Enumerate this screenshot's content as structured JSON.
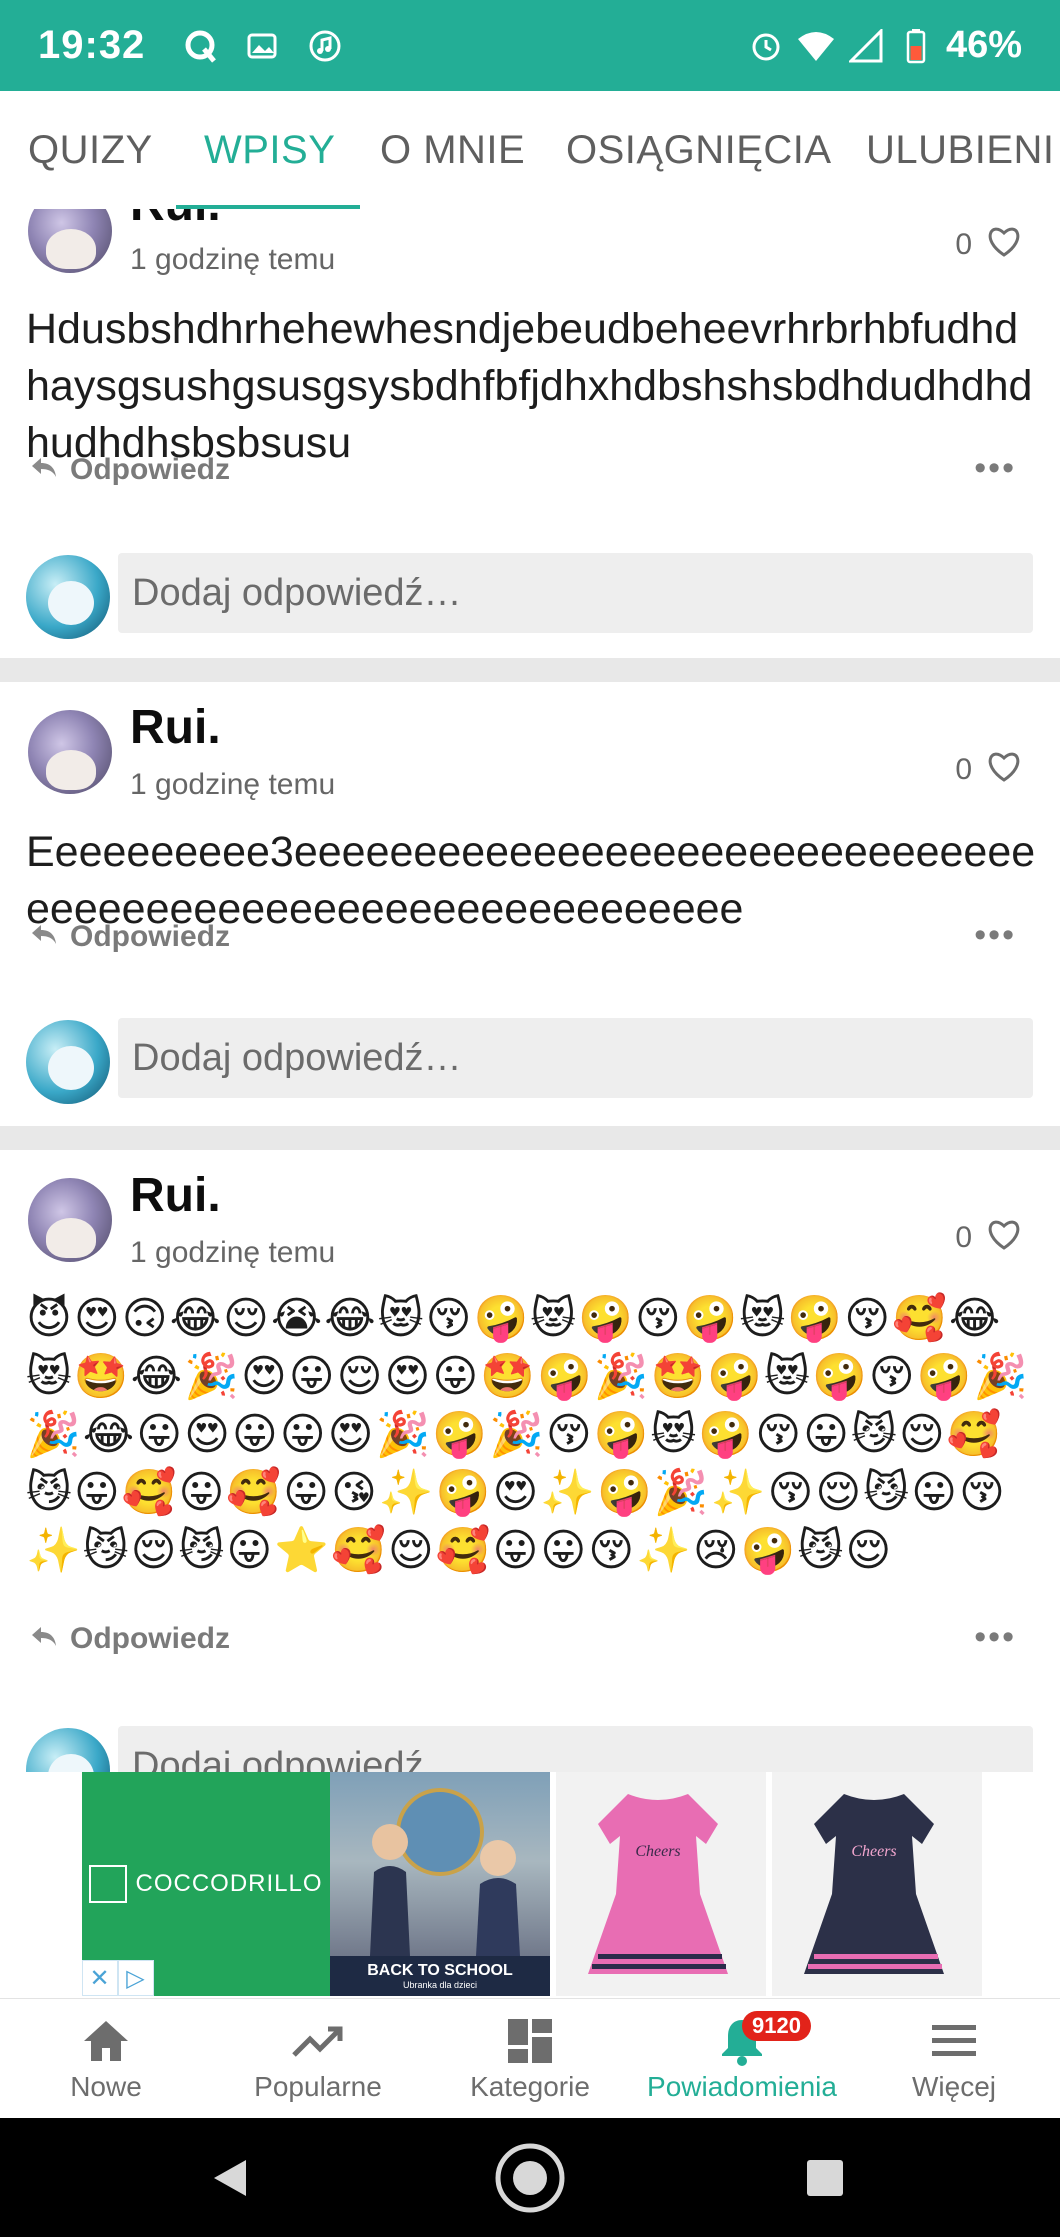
{
  "status_bar": {
    "time": "19:32",
    "battery": "46%",
    "color": "#23ae96"
  },
  "tabs": [
    {
      "label": "QUIZY",
      "active": false
    },
    {
      "label": "WPISY",
      "active": true
    },
    {
      "label": "O MNIE",
      "active": false
    },
    {
      "label": "OSIĄGNIĘCIA",
      "active": false
    },
    {
      "label": "ULUBIENI",
      "active": false
    }
  ],
  "posts": [
    {
      "author": "Rui.",
      "time": "1 godzinę temu",
      "likes": "0",
      "text": "Hdusbshdhrhehewhesndjebeudbeheevrhrbrhbfudhdhaysgsushgsusgsysbdhfbfjdhxhdbshshsbdhdudhdhdhudhdhsbsbsusu",
      "reply_label": "Odpowiedz",
      "more": "•••"
    },
    {
      "author": "Rui.",
      "time": "1 godzinę temu",
      "likes": "0",
      "text": "Eeeeeeeeee3eeeeeeeeeeeeeeeeeeeeeeeeeeeeeeeeeeeeeeeeeeeeeeeeeeeeeeeeeeeee",
      "reply_label": "Odpowiedz",
      "more": "•••"
    },
    {
      "author": "Rui.",
      "time": "1 godzinę temu",
      "likes": "0",
      "text": "😈😍🙃😂😌😭😂😻😚🤪😻🤪😚🤪😻🤪😚🥰😂😻🤩😂🎉😍😛😌😍😛🤩🤪🎉🤩🤪😻🤪😚🤪🎉🎉😂😛😍😛😛😍🎉🤪🎉😚🤪😻🤪😚😛😼😌🥰😼😛🥰😛🥰😛😘✨🤪😍✨🤪🎉✨😚😌😼😛😚✨😼😌😼😛⭐🥰😌🥰😛😛😚✨😢🤪😼😌",
      "reply_label": "Odpowiedz",
      "more": "•••"
    }
  ],
  "reply_input": {
    "placeholder": "Dodaj odpowiedź…"
  },
  "ad": {
    "brand": "COCCODRILLO",
    "caption": "BACK TO SCHOOL",
    "sub_caption": "Ubranka dla dzieci",
    "dress_text": "Cheers",
    "close_glyph": "✕",
    "adchoices_glyph": "▷"
  },
  "bottom_nav": [
    {
      "label": "Nowe",
      "icon": "home-icon",
      "active": false
    },
    {
      "label": "Popularne",
      "icon": "trending-icon",
      "active": false
    },
    {
      "label": "Kategorie",
      "icon": "dashboard-icon",
      "active": false
    },
    {
      "label": "Powiadomienia",
      "icon": "bell-icon",
      "active": true,
      "badge": "9120"
    },
    {
      "label": "Więcej",
      "icon": "menu-icon",
      "active": false
    }
  ]
}
